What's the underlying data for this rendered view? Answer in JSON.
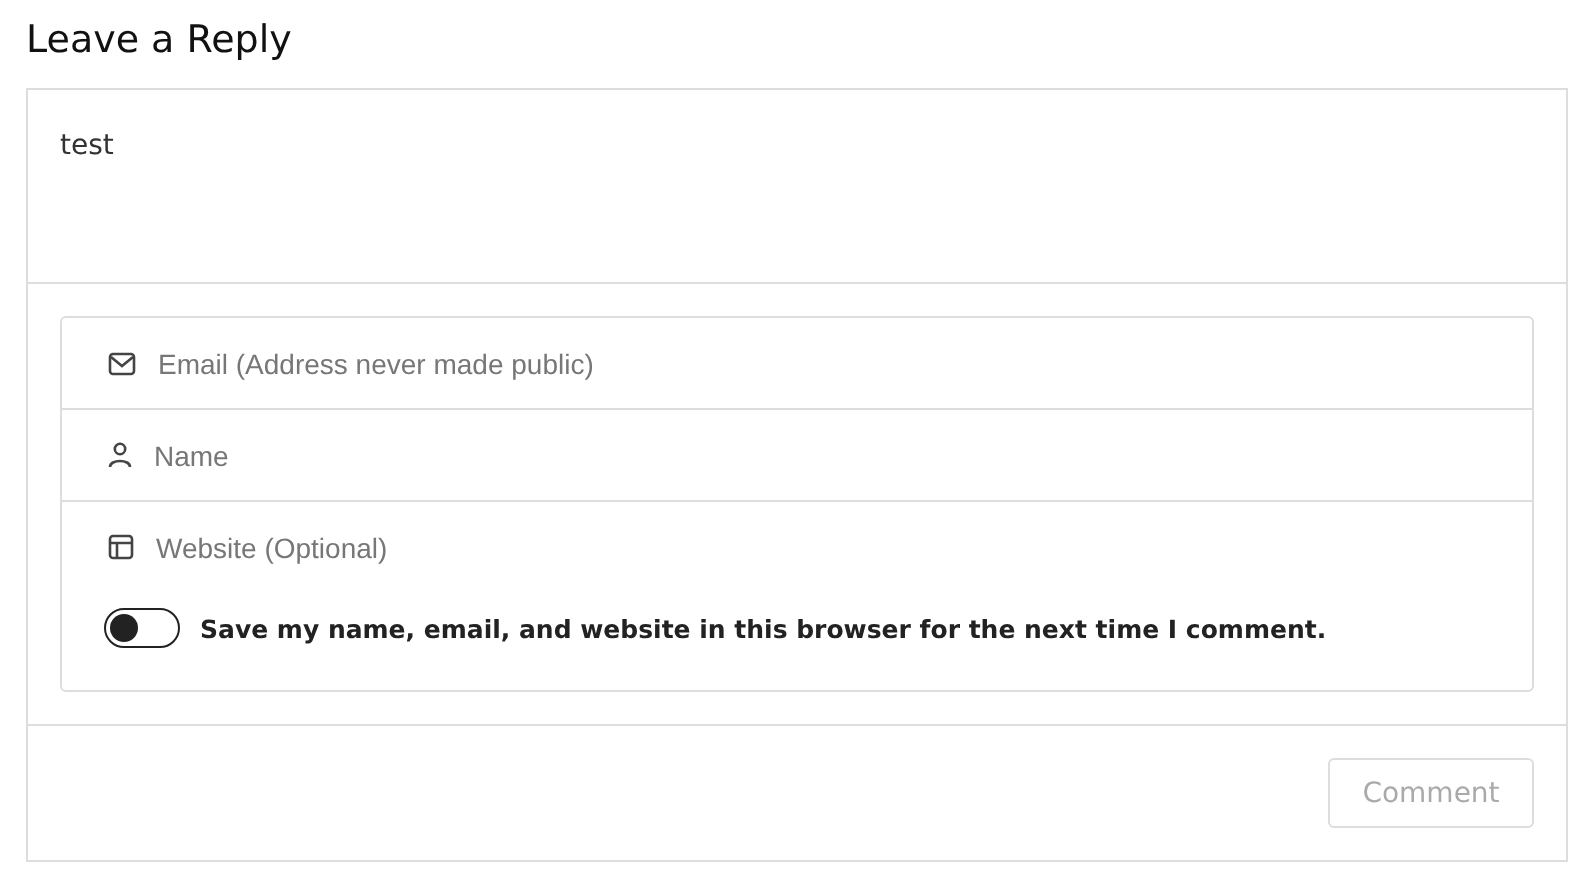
{
  "title": "Leave a Reply",
  "comment": {
    "value": "test"
  },
  "fields": [
    {
      "kind": "email",
      "placeholder": "Email (Address never made public)"
    },
    {
      "kind": "name",
      "placeholder": "Name"
    },
    {
      "kind": "website",
      "placeholder": "Website (Optional)"
    }
  ],
  "save_toggle": {
    "on": false,
    "label": "Save my name, email, and website in this browser for the next time I comment."
  },
  "submit": {
    "label": "Comment",
    "disabled": true
  }
}
